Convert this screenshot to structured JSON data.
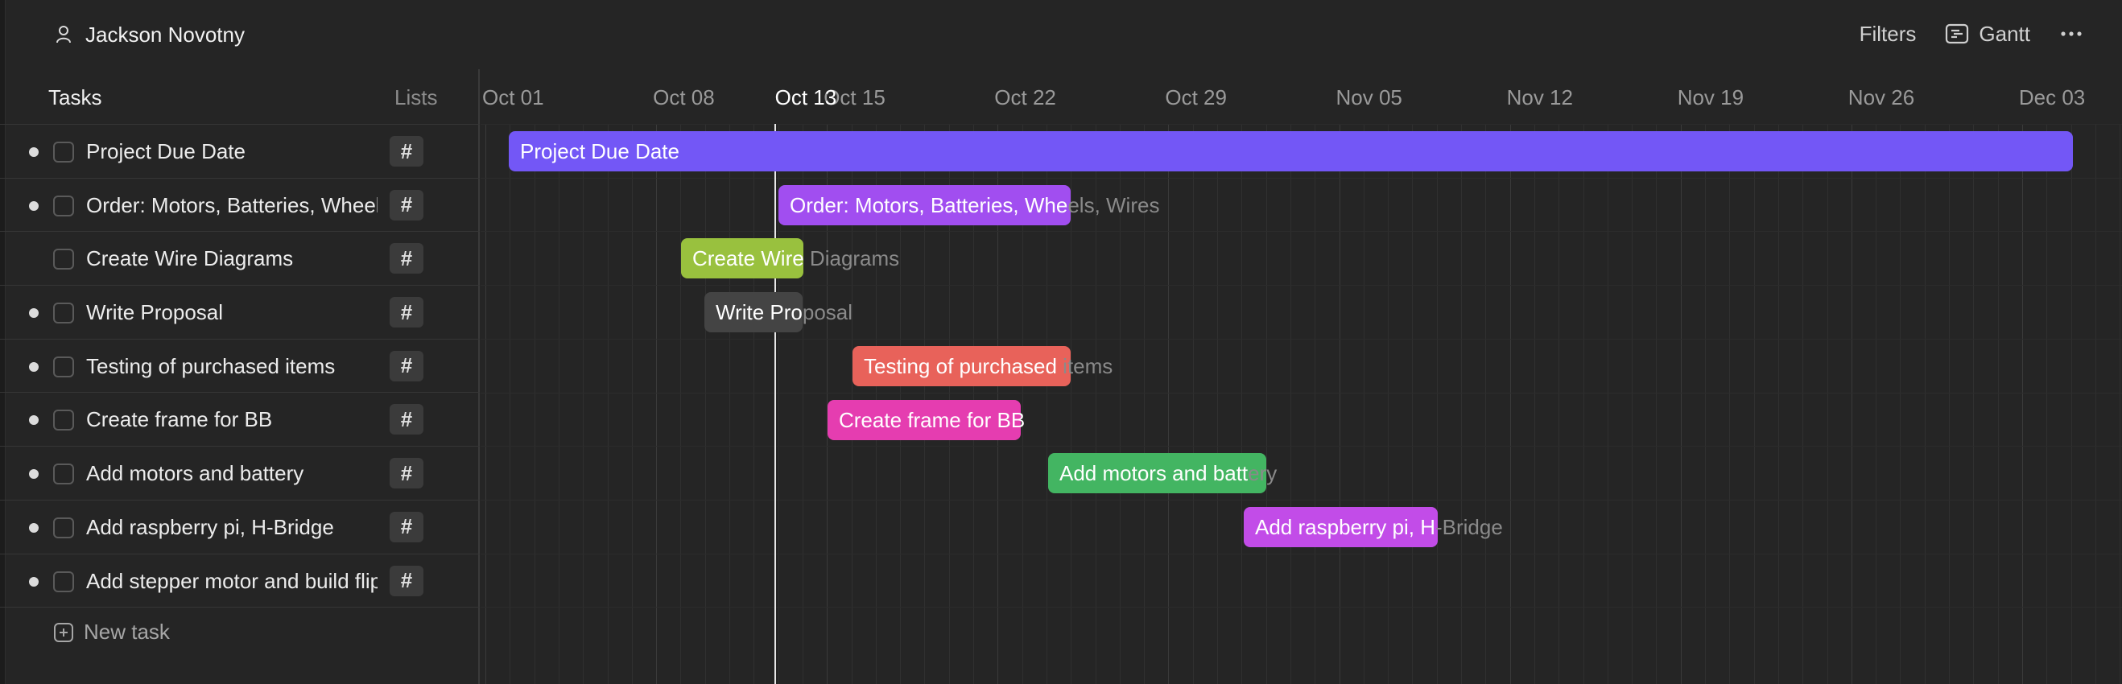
{
  "header": {
    "user_name": "Jackson Novotny",
    "filters_label": "Filters",
    "view_label": "Gantt"
  },
  "task_list": {
    "col_tasks": "Tasks",
    "col_lists": "Lists",
    "tag_symbol": "#",
    "new_task_label": "New task",
    "tasks": [
      {
        "name": "Project Due Date",
        "dot": true
      },
      {
        "name": "Order: Motors, Batteries, Wheels, Wires",
        "dot": true
      },
      {
        "name": "Create Wire Diagrams",
        "dot": false
      },
      {
        "name": "Write Proposal",
        "dot": true
      },
      {
        "name": "Testing of purchased items",
        "dot": true
      },
      {
        "name": "Create frame for BB",
        "dot": true
      },
      {
        "name": "Add motors and battery",
        "dot": true
      },
      {
        "name": "Add raspberry pi, H-Bridge",
        "dot": true
      },
      {
        "name": "Add stepper motor and build flipper",
        "dot": true
      }
    ]
  },
  "timeline": {
    "dates": [
      "Oct 01",
      "Oct 08",
      "Oct 15",
      "Oct 22",
      "Oct 29",
      "Nov 05",
      "Nov 12",
      "Nov 19",
      "Nov 26",
      "Dec 03"
    ],
    "today_label": "Oct 13",
    "bars": [
      {
        "label": "Project Due Date",
        "color": "#7357f6",
        "in": "Project Due Date",
        "out": ""
      },
      {
        "label": "Order: Motors, Batteries, Wheels, Wires",
        "color": "#a14ef0",
        "in": "Order: Motors, Batteries, Whe",
        "out": "els, Wires"
      },
      {
        "label": "Create Wire Diagrams",
        "color": "#99c13e",
        "in": "Create Wire",
        "out": " Diagrams"
      },
      {
        "label": "Write Proposal",
        "color": "#444444",
        "in": "Write Pro",
        "out": "posal"
      },
      {
        "label": "Testing of purchased items",
        "color": "#e8625a",
        "in": "Testing of purchased",
        "out": " items"
      },
      {
        "label": "Create frame for BB",
        "color": "#e53db0",
        "in": "Create frame for BB",
        "out": ""
      },
      {
        "label": "Add motors and battery",
        "color": "#43b562",
        "in": "Add motors and batt",
        "out": "ery"
      },
      {
        "label": "Add raspberry pi, H-Bridge",
        "color": "#c24ce8",
        "in": "Add raspberry pi, H",
        "out": "-Bridge"
      }
    ]
  }
}
